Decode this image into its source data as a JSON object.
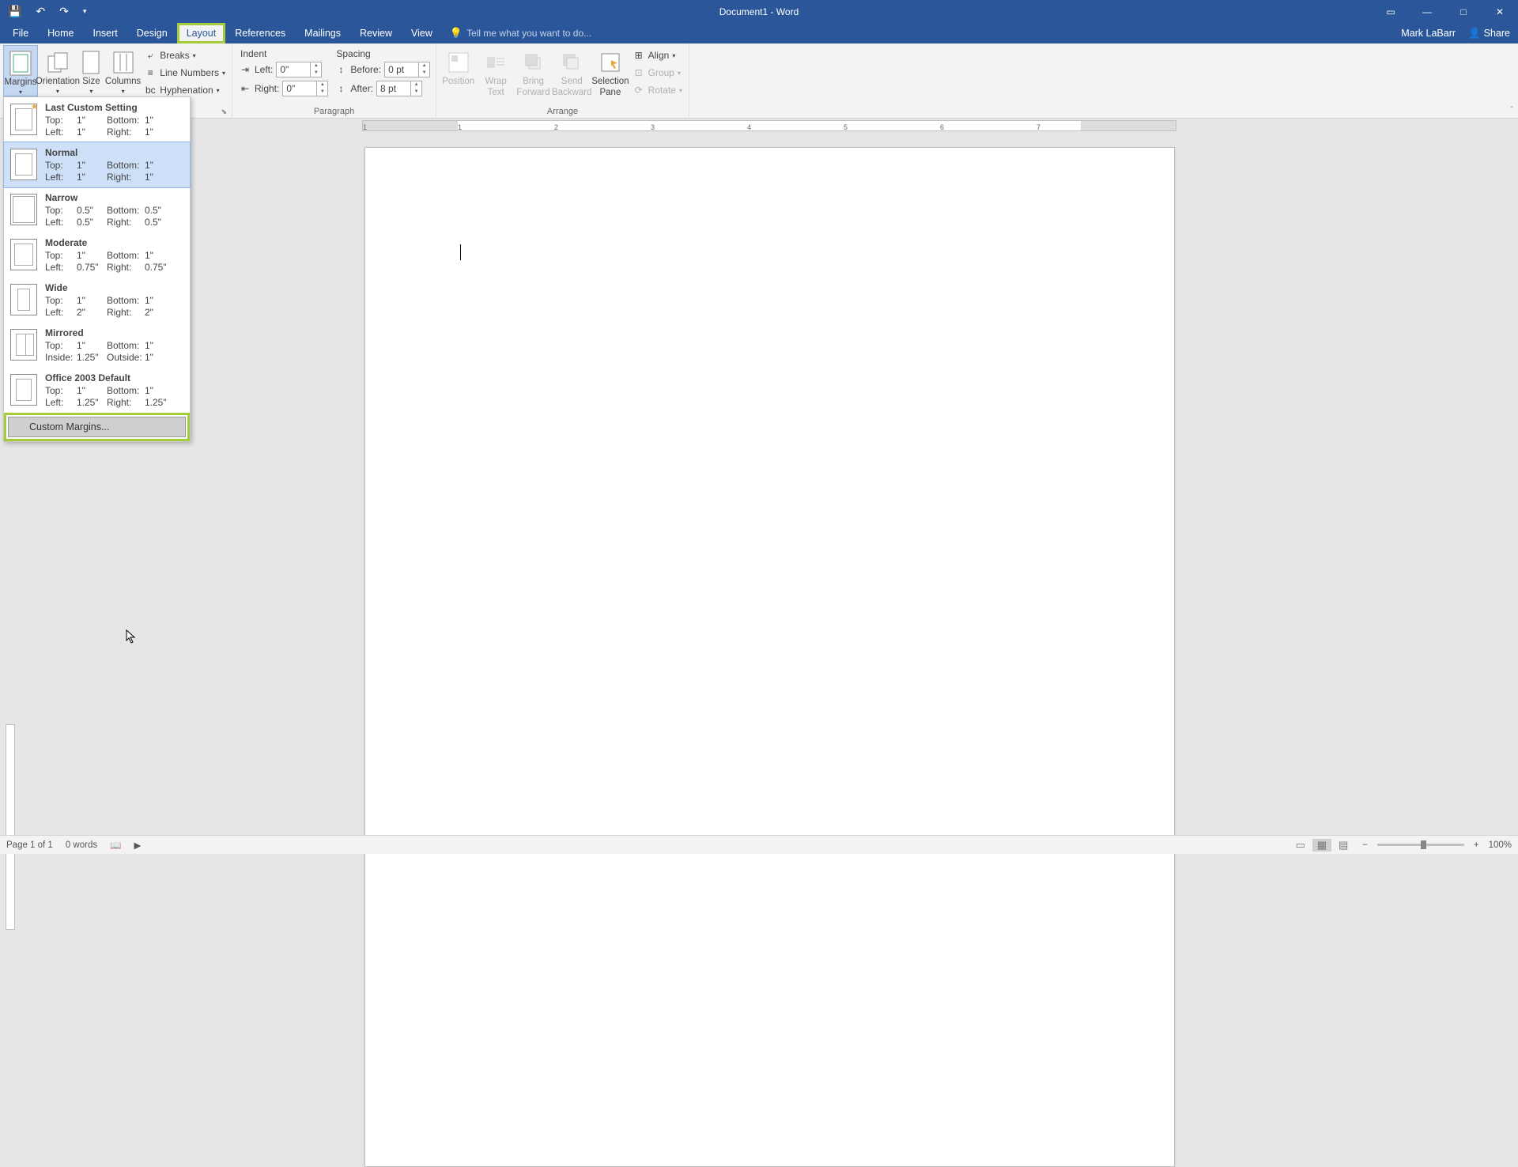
{
  "titlebar": {
    "title": "Document1 - Word"
  },
  "tabs": {
    "file": "File",
    "home": "Home",
    "insert": "Insert",
    "design": "Design",
    "layout": "Layout",
    "references": "References",
    "mailings": "Mailings",
    "review": "Review",
    "view": "View",
    "tellme_placeholder": "Tell me what you want to do...",
    "user": "Mark LaBarr",
    "share": "Share"
  },
  "ribbon": {
    "page_setup": {
      "margins": "Margins",
      "orientation": "Orientation",
      "size": "Size",
      "columns": "Columns",
      "breaks": "Breaks",
      "line_numbers": "Line Numbers",
      "hyphenation": "Hyphenation"
    },
    "paragraph": {
      "label": "Paragraph",
      "indent_label": "Indent",
      "spacing_label": "Spacing",
      "left_label": "Left:",
      "right_label": "Right:",
      "before_label": "Before:",
      "after_label": "After:",
      "left_val": "0\"",
      "right_val": "0\"",
      "before_val": "0 pt",
      "after_val": "8 pt"
    },
    "arrange": {
      "label": "Arrange",
      "position": "Position",
      "wrap_text": "Wrap\nText",
      "bring_forward": "Bring\nForward",
      "send_backward": "Send\nBackward",
      "selection_pane": "Selection\nPane",
      "align": "Align",
      "group": "Group",
      "rotate": "Rotate"
    }
  },
  "margins_menu": {
    "items": [
      {
        "name": "Last Custom Setting",
        "icon": "lastcustom",
        "r1c1": "Top:",
        "r1c2": "1\"",
        "r1c3": "Bottom:",
        "r1c4": "1\"",
        "r2c1": "Left:",
        "r2c2": "1\"",
        "r2c3": "Right:",
        "r2c4": "1\""
      },
      {
        "name": "Normal",
        "icon": "normal",
        "selected": true,
        "r1c1": "Top:",
        "r1c2": "1\"",
        "r1c3": "Bottom:",
        "r1c4": "1\"",
        "r2c1": "Left:",
        "r2c2": "1\"",
        "r2c3": "Right:",
        "r2c4": "1\""
      },
      {
        "name": "Narrow",
        "icon": "narrow",
        "r1c1": "Top:",
        "r1c2": "0.5\"",
        "r1c3": "Bottom:",
        "r1c4": "0.5\"",
        "r2c1": "Left:",
        "r2c2": "0.5\"",
        "r2c3": "Right:",
        "r2c4": "0.5\""
      },
      {
        "name": "Moderate",
        "icon": "moderate",
        "r1c1": "Top:",
        "r1c2": "1\"",
        "r1c3": "Bottom:",
        "r1c4": "1\"",
        "r2c1": "Left:",
        "r2c2": "0.75\"",
        "r2c3": "Right:",
        "r2c4": "0.75\""
      },
      {
        "name": "Wide",
        "icon": "wide",
        "r1c1": "Top:",
        "r1c2": "1\"",
        "r1c3": "Bottom:",
        "r1c4": "1\"",
        "r2c1": "Left:",
        "r2c2": "2\"",
        "r2c3": "Right:",
        "r2c4": "2\""
      },
      {
        "name": "Mirrored",
        "icon": "mirrored",
        "r1c1": "Top:",
        "r1c2": "1\"",
        "r1c3": "Bottom:",
        "r1c4": "1\"",
        "r2c1": "Inside:",
        "r2c2": "1.25\"",
        "r2c3": "Outside:",
        "r2c4": "1\""
      },
      {
        "name": "Office 2003 Default",
        "icon": "office2003",
        "r1c1": "Top:",
        "r1c2": "1\"",
        "r1c3": "Bottom:",
        "r1c4": "1\"",
        "r2c1": "Left:",
        "r2c2": "1.25\"",
        "r2c3": "Right:",
        "r2c4": "1.25\""
      }
    ],
    "custom": "Custom Margins..."
  },
  "ruler": {
    "nums": [
      "1",
      "2",
      "3",
      "4",
      "5",
      "6",
      "7"
    ]
  },
  "status": {
    "page": "Page 1 of 1",
    "words": "0 words",
    "zoom": "100%"
  }
}
